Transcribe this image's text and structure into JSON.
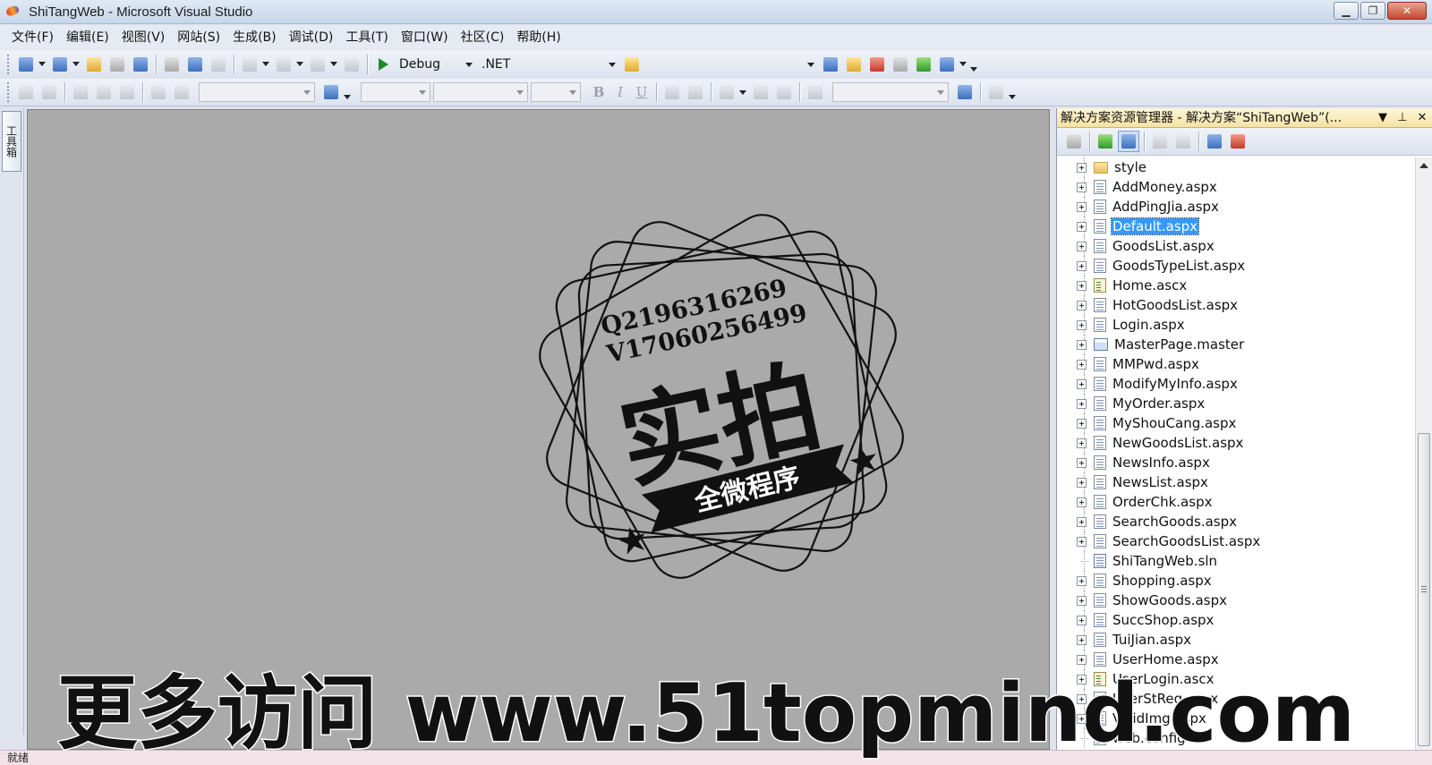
{
  "window": {
    "title": "ShiTangWeb - Microsoft Visual Studio",
    "minimize_label": "▁",
    "restore_label": "❐",
    "close_label": "✕"
  },
  "menu": [
    "文件(F)",
    "编辑(E)",
    "视图(V)",
    "网站(S)",
    "生成(B)",
    "调试(D)",
    "工具(T)",
    "窗口(W)",
    "社区(C)",
    "帮助(H)"
  ],
  "toolbar": {
    "config": "Debug",
    "platform": ".NET"
  },
  "toolbox": {
    "label": "工具箱"
  },
  "stamp": {
    "line1": "Q2196316269",
    "line2": "V17060256499",
    "big_text": "实拍",
    "banner": "全微程序"
  },
  "solution_explorer": {
    "title": "解决方案资源管理器 - 解决方案“ShiTangWeb”(...",
    "pin_label": "⊥",
    "close_label": "✕",
    "selected": "Default.aspx",
    "items": [
      {
        "name": "style",
        "type": "folder",
        "expandable": true
      },
      {
        "name": "AddMoney.aspx",
        "type": "aspx",
        "expandable": true
      },
      {
        "name": "AddPingJia.aspx",
        "type": "aspx",
        "expandable": true
      },
      {
        "name": "Default.aspx",
        "type": "aspx",
        "expandable": true
      },
      {
        "name": "GoodsList.aspx",
        "type": "aspx",
        "expandable": true
      },
      {
        "name": "GoodsTypeList.aspx",
        "type": "aspx",
        "expandable": true
      },
      {
        "name": "Home.ascx",
        "type": "ascx",
        "expandable": true
      },
      {
        "name": "HotGoodsList.aspx",
        "type": "aspx",
        "expandable": true
      },
      {
        "name": "Login.aspx",
        "type": "aspx",
        "expandable": true
      },
      {
        "name": "MasterPage.master",
        "type": "master",
        "expandable": true
      },
      {
        "name": "MMPwd.aspx",
        "type": "aspx",
        "expandable": true
      },
      {
        "name": "ModifyMyInfo.aspx",
        "type": "aspx",
        "expandable": true
      },
      {
        "name": "MyOrder.aspx",
        "type": "aspx",
        "expandable": true
      },
      {
        "name": "MyShouCang.aspx",
        "type": "aspx",
        "expandable": true
      },
      {
        "name": "NewGoodsList.aspx",
        "type": "aspx",
        "expandable": true
      },
      {
        "name": "NewsInfo.aspx",
        "type": "aspx",
        "expandable": true
      },
      {
        "name": "NewsList.aspx",
        "type": "aspx",
        "expandable": true
      },
      {
        "name": "OrderChk.aspx",
        "type": "aspx",
        "expandable": true
      },
      {
        "name": "SearchGoods.aspx",
        "type": "aspx",
        "expandable": true
      },
      {
        "name": "SearchGoodsList.aspx",
        "type": "aspx",
        "expandable": true
      },
      {
        "name": "ShiTangWeb.sln",
        "type": "sln",
        "expandable": false
      },
      {
        "name": "Shopping.aspx",
        "type": "aspx",
        "expandable": true
      },
      {
        "name": "ShowGoods.aspx",
        "type": "aspx",
        "expandable": true
      },
      {
        "name": "SuccShop.aspx",
        "type": "aspx",
        "expandable": true
      },
      {
        "name": "TuiJian.aspx",
        "type": "aspx",
        "expandable": true
      },
      {
        "name": "UserHome.aspx",
        "type": "aspx",
        "expandable": true
      },
      {
        "name": "UserLogin.ascx",
        "type": "ascx",
        "expandable": true
      },
      {
        "name": "UserStReg.aspx",
        "type": "aspx",
        "expandable": true
      },
      {
        "name": "ValidImg.aspx",
        "type": "aspx",
        "expandable": true
      },
      {
        "name": "web.config",
        "type": "aspx",
        "expandable": false
      }
    ]
  },
  "statusbar": {
    "text": "就绪"
  },
  "watermark": {
    "text": "更多访问 www.51topmind.com"
  }
}
